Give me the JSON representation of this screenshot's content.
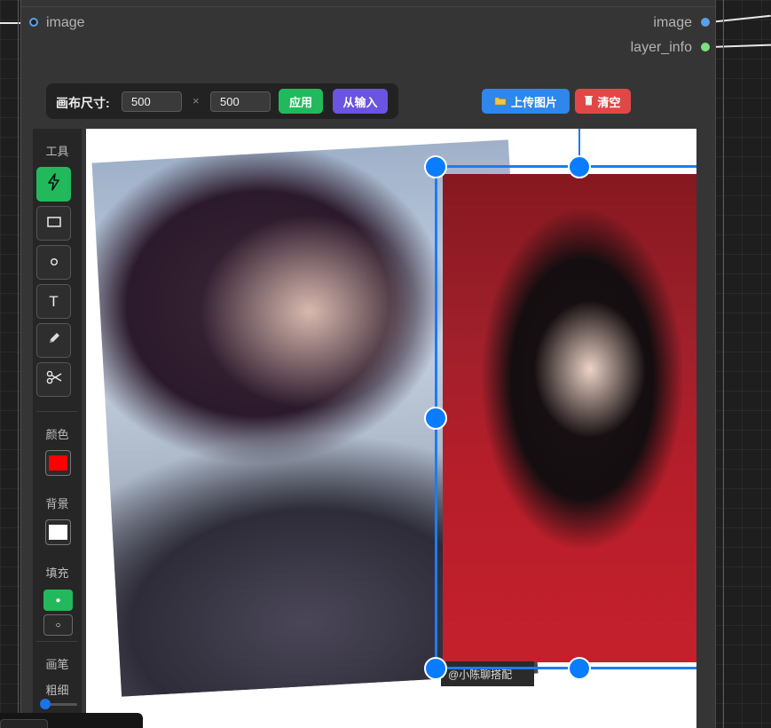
{
  "node": {
    "input_image_label": "image",
    "output_image_label": "image",
    "output_layer_label": "layer_info",
    "image_socket_color": "#5aa0e6",
    "layer_socket_color": "#7ee07e"
  },
  "canvas_size": {
    "label": "画布尺寸:",
    "width_value": "500",
    "height_value": "500",
    "times": "×",
    "apply_label": "应用",
    "from_input_label": "从输入"
  },
  "actions": {
    "upload_label": "上传图片",
    "clear_label": "清空"
  },
  "toolbar": {
    "tools_label": "工具",
    "color_label": "颜色",
    "bg_label": "背景",
    "fill_label": "填充",
    "brush_label": "画笔",
    "thickness_label": "粗细",
    "text_tool_glyph": "T",
    "color_value": "#ff0000",
    "bg_value": "#ffffff",
    "active_tool": "lightning"
  },
  "watermark": "@小陈聊搭配"
}
